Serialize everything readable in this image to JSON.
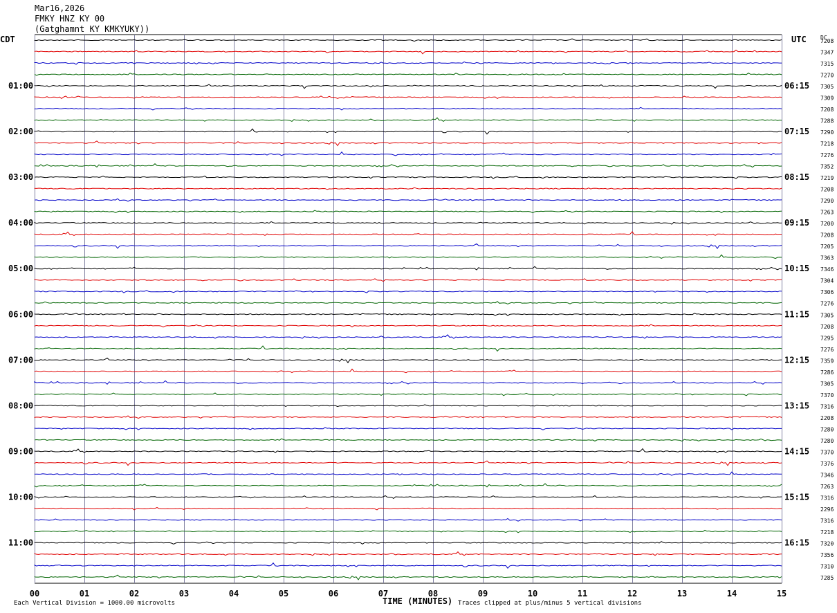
{
  "header": {
    "date": "Mar16,2026",
    "station": "FMKY HNZ KY 00",
    "location": "(Gatghamnt KY KMKYUKY))"
  },
  "chart_data": {
    "type": "line",
    "subtype": "helicorder",
    "left_timezone": "CDT",
    "right_timezone": "UTC",
    "dc_label": "DC",
    "left_hour_labels": [
      "01:00",
      "02:00",
      "03:00",
      "04:00",
      "05:00",
      "06:00",
      "07:00",
      "08:00",
      "09:00",
      "10:00",
      "11:00"
    ],
    "right_hour_labels": [
      "06:15",
      "07:15",
      "08:15",
      "09:15",
      "10:15",
      "11:15",
      "12:15",
      "13:15",
      "14:15",
      "15:15",
      "16:15"
    ],
    "x_ticks": [
      "00",
      "01",
      "02",
      "03",
      "04",
      "05",
      "06",
      "07",
      "08",
      "09",
      "10",
      "11",
      "12",
      "13",
      "14",
      "15"
    ],
    "xlabel": "TIME (MINUTES)",
    "xlim": [
      0,
      15
    ],
    "rows": 48,
    "trace_colors": [
      "#000000",
      "#e00000",
      "#0000c8",
      "#006400"
    ],
    "grid_color": "#8080a0",
    "dc_values": [
      "7208",
      "7347",
      "7315",
      "7270",
      "7305",
      "7309",
      "7208",
      "7288",
      "7290",
      "7218",
      "7276",
      "7352",
      "7219",
      "7208",
      "7290",
      "7263",
      "7200",
      "7208",
      "7205",
      "7363",
      "7346",
      "7304",
      "7306",
      "7276",
      "7305",
      "7208",
      "7295",
      "7276",
      "7359",
      "7286",
      "7305",
      "7370",
      "7316",
      "2208",
      "7280",
      "7280",
      "7370",
      "7376",
      "7346",
      "7263",
      "7316",
      "2296",
      "7316",
      "7218",
      "7320",
      "7356",
      "7310",
      "7285"
    ],
    "footer_left": "Each Vertical Division = 1000.00 microvolts",
    "footer_right": "Traces clipped at plus/minus 5 vertical divisions"
  }
}
